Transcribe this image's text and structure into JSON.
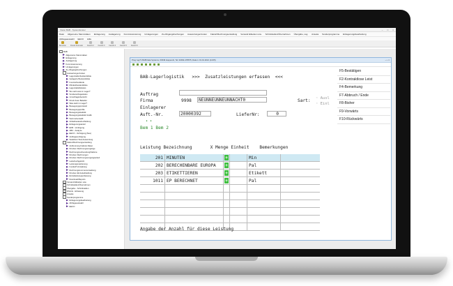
{
  "app": {
    "title": "Vision BAB - Systemfenster",
    "menus": [
      "Datei",
      "Allgemeine Stammdaten",
      "Einlagerung",
      "Auslagerung",
      "Kommissionierung",
      "Umlagerungen",
      "Zu-/Abgangsbuchungen",
      "Auswertungen/Listen",
      "Fakturi/Rechnungserstellung",
      "Versand Etiketten usw.",
      "Schnittstellen/Übernahmen",
      "Übergabe, sog.",
      "Anseka",
      "Sonderprogramme",
      "Einlagerungsbearbeitung"
    ],
    "menus2": [
      "Abfrageauswahl",
      "EECO",
      "Hilfe"
    ],
    "toolbar": [
      "Benutzer",
      "Druckt Formular",
      "Favorit 2",
      "Favorit 3",
      "Favorit 4",
      "Favorit 5",
      "Favorit 6"
    ]
  },
  "tree": [
    {
      "label": "BAB",
      "lvl": 0,
      "kind": "box"
    },
    {
      "label": "Allgemeine Stammdaten",
      "lvl": 1,
      "kind": "arrow"
    },
    {
      "label": "Einlagerung",
      "lvl": 1,
      "kind": "arrow"
    },
    {
      "label": "Auslagerung",
      "lvl": 1,
      "kind": "arrow"
    },
    {
      "label": "Kommissionierung",
      "lvl": 1,
      "kind": "arrow"
    },
    {
      "label": "Umlagerungen",
      "lvl": 1,
      "kind": "arrow"
    },
    {
      "label": "Zu-/Abgangsbuchungen",
      "lvl": 1,
      "kind": "arrow"
    },
    {
      "label": "Auswertungen/Listen",
      "lvl": 1,
      "kind": "box"
    },
    {
      "label": "Lagerstellenbestandsliste",
      "lvl": 2,
      "kind": "arrow"
    },
    {
      "label": "Gelagerte Bestandsliste",
      "lvl": 2,
      "kind": "arrow"
    },
    {
      "label": "Inventurbestände",
      "lvl": 2,
      "kind": "arrow"
    },
    {
      "label": "Mindestbestandsliste",
      "lvl": 2,
      "kind": "arrow"
    },
    {
      "label": "Lagerstatistikstatus",
      "lvl": 2,
      "kind": "arrow"
    },
    {
      "label": "Wo steht was im Lager?",
      "lvl": 2,
      "kind": "arrow"
    },
    {
      "label": "Sonderanfragestatus",
      "lvl": 2,
      "kind": "arrow"
    },
    {
      "label": "Umschlagsübersicht",
      "lvl": 2,
      "kind": "arrow"
    },
    {
      "label": "Druck freier Belielfer",
      "lvl": 2,
      "kind": "arrow"
    },
    {
      "label": "Was steht im Lager?",
      "lvl": 2,
      "kind": "arrow"
    },
    {
      "label": "Bewegungsprotokoll",
      "lvl": 2,
      "kind": "arrow"
    },
    {
      "label": "Bewegungsprofile",
      "lvl": 2,
      "kind": "arrow"
    },
    {
      "label": "Bewegungsstatistik",
      "lvl": 2,
      "kind": "arrow"
    },
    {
      "label": "Bewegungsstatistik Grafik",
      "lvl": 2,
      "kind": "arrow"
    },
    {
      "label": "Sammelverwaltl.",
      "lvl": 2,
      "kind": "arrow"
    },
    {
      "label": "Artikelbestands-Meldung",
      "lvl": 2,
      "kind": "arrow"
    },
    {
      "label": "Einlagerungsanteil",
      "lvl": 2,
      "kind": "arrow"
    },
    {
      "label": "EKB - Verfolgung",
      "lvl": 2,
      "kind": "arrow"
    },
    {
      "label": "ABC - Analyse",
      "lvl": 2,
      "kind": "arrow"
    },
    {
      "label": "EECO - Verfolgung (Neu)",
      "lvl": 2,
      "kind": "arrow"
    },
    {
      "label": "Auftragsverfolgung",
      "lvl": 2,
      "kind": "arrow"
    },
    {
      "label": "Selektiver Stat-Auswertung",
      "lvl": 2,
      "kind": "arrow"
    },
    {
      "label": "Fakturi/Rechnungserstellung",
      "lvl": 1,
      "kind": "box"
    },
    {
      "label": "Auftrennung Faktura Daten",
      "lvl": 2,
      "kind": "arrow"
    },
    {
      "label": "Drucken Rechnungsvorgänge",
      "lvl": 2,
      "kind": "arrow"
    },
    {
      "label": "Rechnungsvorbereitung/Fakture",
      "lvl": 2,
      "kind": "arrow"
    },
    {
      "label": "Drucken Rechnungen",
      "lvl": 2,
      "kind": "arrow"
    },
    {
      "label": "Drucken Rechnungsvorgangsanteil",
      "lvl": 2,
      "kind": "arrow"
    },
    {
      "label": "Lieferbuchgebühr",
      "lvl": 2,
      "kind": "arrow"
    },
    {
      "label": "Leistungsmarkierung",
      "lvl": 2,
      "kind": "arrow"
    },
    {
      "label": "Invoikoff Verwaltung",
      "lvl": 2,
      "kind": "arrow"
    },
    {
      "label": "Rechnungsnummerverwaltung",
      "lvl": 2,
      "kind": "arrow"
    },
    {
      "label": "Drucken Einzelaufstellung",
      "lvl": 2,
      "kind": "arrow"
    },
    {
      "label": "Einzelleistungserfassung",
      "lvl": 2,
      "kind": "arrow"
    },
    {
      "label": "Download/Reports",
      "lvl": 2,
      "kind": "arrow"
    },
    {
      "label": "Versand Etiketten usw.",
      "lvl": 1,
      "kind": "box"
    },
    {
      "label": "Schnittstellen/Übernahmen",
      "lvl": 1,
      "kind": "box"
    },
    {
      "label": "Übergabe - Schnittstellen",
      "lvl": 1,
      "kind": "box"
    },
    {
      "label": "DSLink - Erfassung",
      "lvl": 1,
      "kind": "box"
    },
    {
      "label": "Anseka",
      "lvl": 1,
      "kind": "box"
    },
    {
      "label": "Sonderprogramme",
      "lvl": 1,
      "kind": "box"
    },
    {
      "label": "Einlagerungsbearbeitung",
      "lvl": 2,
      "kind": "arrow"
    },
    {
      "label": "Abfrageauswahl",
      "lvl": 2,
      "kind": "arrow"
    },
    {
      "label": "EECO",
      "lvl": 2,
      "kind": "arrow"
    }
  ],
  "child": {
    "title": "Prog: leg71 BAB Data Systems, 63349 Hoppenöl, Tel: 02002-478675, Datum: 19.01.2021 (14:05)",
    "header": "BAB-Lagerlogistik   >>>  Zusatzleistungen erfassen  <<<",
    "auftrag_label": "Auftrag",
    "firma_label": "Firma",
    "firma_nr": "9998",
    "firma_name": "NEUNNEUNNEUNNACHT0",
    "sart_label": "Sart:",
    "sart_opt1": "Ausl",
    "sart_opt2": "Einl",
    "einlagerer_label": "Einlagerer",
    "auft_nr_label": "Auft.-Nr.",
    "auft_nr": "20000392",
    "liefer_label": "LieferNr:",
    "liefer_nr": "0",
    "bem": "Bem 1 Bem 2",
    "table_header": "Leistung Bezeichnung       X Menge Einheit    Bemerkungen",
    "rows": [
      {
        "nr": "201",
        "text": "MINUTEN",
        "plus": "+",
        "einheit": "Min",
        "selected": true
      },
      {
        "nr": "202",
        "text": "BERECHENBARE EUROPA",
        "plus": "+",
        "einheit": "Pal",
        "selected": false
      },
      {
        "nr": "203",
        "text": "ETIKETTIEREN",
        "plus": "+",
        "einheit": "Etikett",
        "selected": false
      },
      {
        "nr": "1011",
        "text": "EP BERECHNET",
        "plus": "+",
        "einheit": "Pal",
        "selected": false
      }
    ],
    "empty_rows": 6,
    "footer": "Angabe der Anzahl für diese Leistung",
    "fkeys": [
      "F5-Bestätigen",
      "F2-Kontraktlose Leist",
      "F4-Bemerkung",
      "F7-Abbruch / Ende",
      "F8-Bisher",
      "F9-Vorwärts",
      "F10-Rückwärts"
    ]
  }
}
